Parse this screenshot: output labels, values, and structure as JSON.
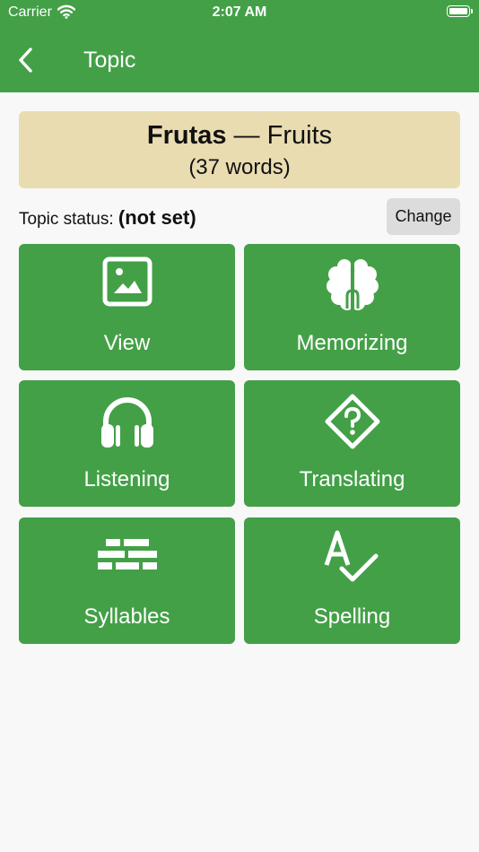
{
  "status_bar": {
    "carrier": "Carrier",
    "time": "2:07 AM"
  },
  "nav": {
    "title": "Topic"
  },
  "topic": {
    "name": "Frutas",
    "dash": " — ",
    "translation": "Fruits",
    "count": "(37 words)"
  },
  "status": {
    "label": "Topic status: ",
    "value": "(not set)",
    "change_label": "Change"
  },
  "tiles": [
    {
      "label": "View",
      "icon": "image-icon"
    },
    {
      "label": "Memorizing",
      "icon": "brain-icon"
    },
    {
      "label": "Listening",
      "icon": "headphones-icon"
    },
    {
      "label": "Translating",
      "icon": "question-diamond-icon"
    },
    {
      "label": "Syllables",
      "icon": "bricks-icon"
    },
    {
      "label": "Spelling",
      "icon": "spell-check-icon"
    }
  ],
  "colors": {
    "primary": "#43a047",
    "topic_card_bg": "#e9dcb1",
    "button_bg": "#dcdcdc",
    "background": "#f8f8f8"
  }
}
